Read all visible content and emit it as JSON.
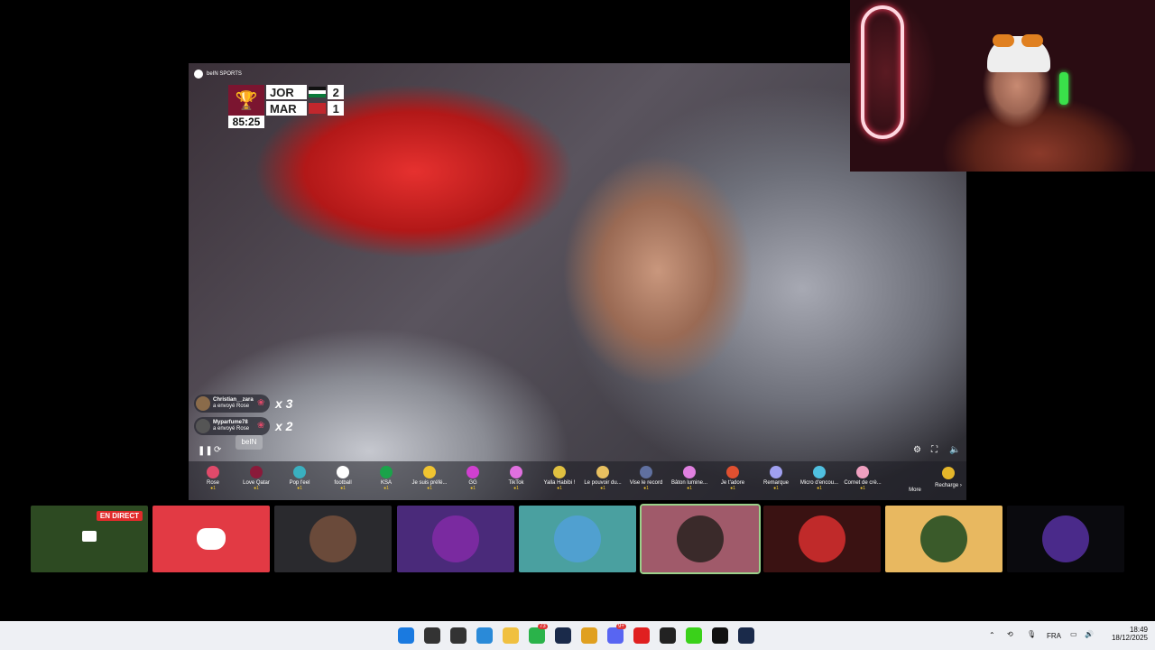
{
  "video": {
    "channel": "beIN SPORTS",
    "match": {
      "clock": "85:25",
      "teams": [
        {
          "code": "JOR",
          "goals": "2",
          "flag_color": "#111111"
        },
        {
          "code": "MAR",
          "goals": "1",
          "flag_color": "#c1272d"
        }
      ]
    },
    "watermark": "beIN",
    "gift_feed": [
      {
        "user": "Christian__zara",
        "action": "a envoyé Rose",
        "multiplier": "x 3"
      },
      {
        "user": "Myparfume78",
        "action": "a envoyé Rose",
        "multiplier": "x 2"
      }
    ],
    "controls": [
      "pause-icon",
      "refresh-icon",
      "settings-icon",
      "expand-icon",
      "volume-icon"
    ]
  },
  "gift_bar": {
    "items": [
      {
        "name": "Rose",
        "price": "●1",
        "color": "#e04a6a"
      },
      {
        "name": "Love Qatar",
        "price": "●1",
        "color": "#8a1a3a"
      },
      {
        "name": "Pop l'eel",
        "price": "●1",
        "color": "#3ab0c0"
      },
      {
        "name": "football",
        "price": "●1",
        "color": "#ffffff"
      },
      {
        "name": "KSA",
        "price": "●1",
        "color": "#1aa34a"
      },
      {
        "name": "Je suis préfé...",
        "price": "●1",
        "color": "#f0c430"
      },
      {
        "name": "GG",
        "price": "●1",
        "color": "#d040d0"
      },
      {
        "name": "TikTok",
        "price": "●1",
        "color": "#e070e0"
      },
      {
        "name": "Yalla Habibi !",
        "price": "●1",
        "color": "#e0c040"
      },
      {
        "name": "Le pouvoir du...",
        "price": "●1",
        "color": "#e8c060"
      },
      {
        "name": "Vise le record",
        "price": "●1",
        "color": "#6070a0"
      },
      {
        "name": "Bâton lumine...",
        "price": "●1",
        "color": "#e080e0"
      },
      {
        "name": "Je t'adore",
        "price": "●1",
        "color": "#e05030"
      },
      {
        "name": "Remarque",
        "price": "●1",
        "color": "#a0a0f0"
      },
      {
        "name": "Micro d'encou...",
        "price": "●1",
        "color": "#50c0e0"
      },
      {
        "name": "Cornet de crè...",
        "price": "●1",
        "color": "#f0a0c0"
      }
    ],
    "more_label": "More",
    "recharge_label": "Recharge ›"
  },
  "strip": {
    "tiles": [
      {
        "type": "live",
        "badge": "EN DIRECT",
        "bg": "#2d4a22"
      },
      {
        "type": "discord",
        "bg": "#e23a44"
      },
      {
        "type": "avatar",
        "bg": "#2a2a2e",
        "avatar": "#6a4a3a"
      },
      {
        "type": "avatar",
        "bg": "#4a2a7a",
        "avatar": "#7a2aa0"
      },
      {
        "type": "avatar",
        "bg": "#4aa0a0",
        "avatar": "#50a0d0"
      },
      {
        "type": "avatar",
        "bg": "#a05a6a",
        "avatar": "#3a2a2a"
      },
      {
        "type": "avatar",
        "bg": "#3a1212",
        "avatar": "#c02a2a"
      },
      {
        "type": "avatar",
        "bg": "#e8b860",
        "avatar": "#3a5a2a"
      },
      {
        "type": "avatar",
        "bg": "#0a0a0e",
        "avatar": "#4a2a8a"
      }
    ]
  },
  "taskbar": {
    "apps": [
      {
        "name": "windows-start-icon",
        "color": "#1a7ae0"
      },
      {
        "name": "search-icon",
        "color": "#333333"
      },
      {
        "name": "task-view-icon",
        "color": "#333333"
      },
      {
        "name": "edge-icon",
        "color": "#2a8ad8"
      },
      {
        "name": "file-explorer-icon",
        "color": "#f0c040"
      },
      {
        "name": "whatsapp-icon",
        "color": "#2ab34a",
        "badge": "73"
      },
      {
        "name": "steam-icon",
        "color": "#1a2a4a"
      },
      {
        "name": "chrome-icon",
        "color": "#e0a020"
      },
      {
        "name": "discord-icon",
        "color": "#5865f2",
        "badge": "9+"
      },
      {
        "name": "youtube-icon",
        "color": "#e02020"
      },
      {
        "name": "obs-icon",
        "color": "#222222"
      },
      {
        "name": "kick-icon",
        "color": "#3ad11a"
      },
      {
        "name": "tiktok-icon",
        "color": "#111111"
      },
      {
        "name": "steam-icon-2",
        "color": "#1a2a4a"
      }
    ],
    "language": "FRA",
    "time": "18:49",
    "date": "18/12/2025"
  }
}
